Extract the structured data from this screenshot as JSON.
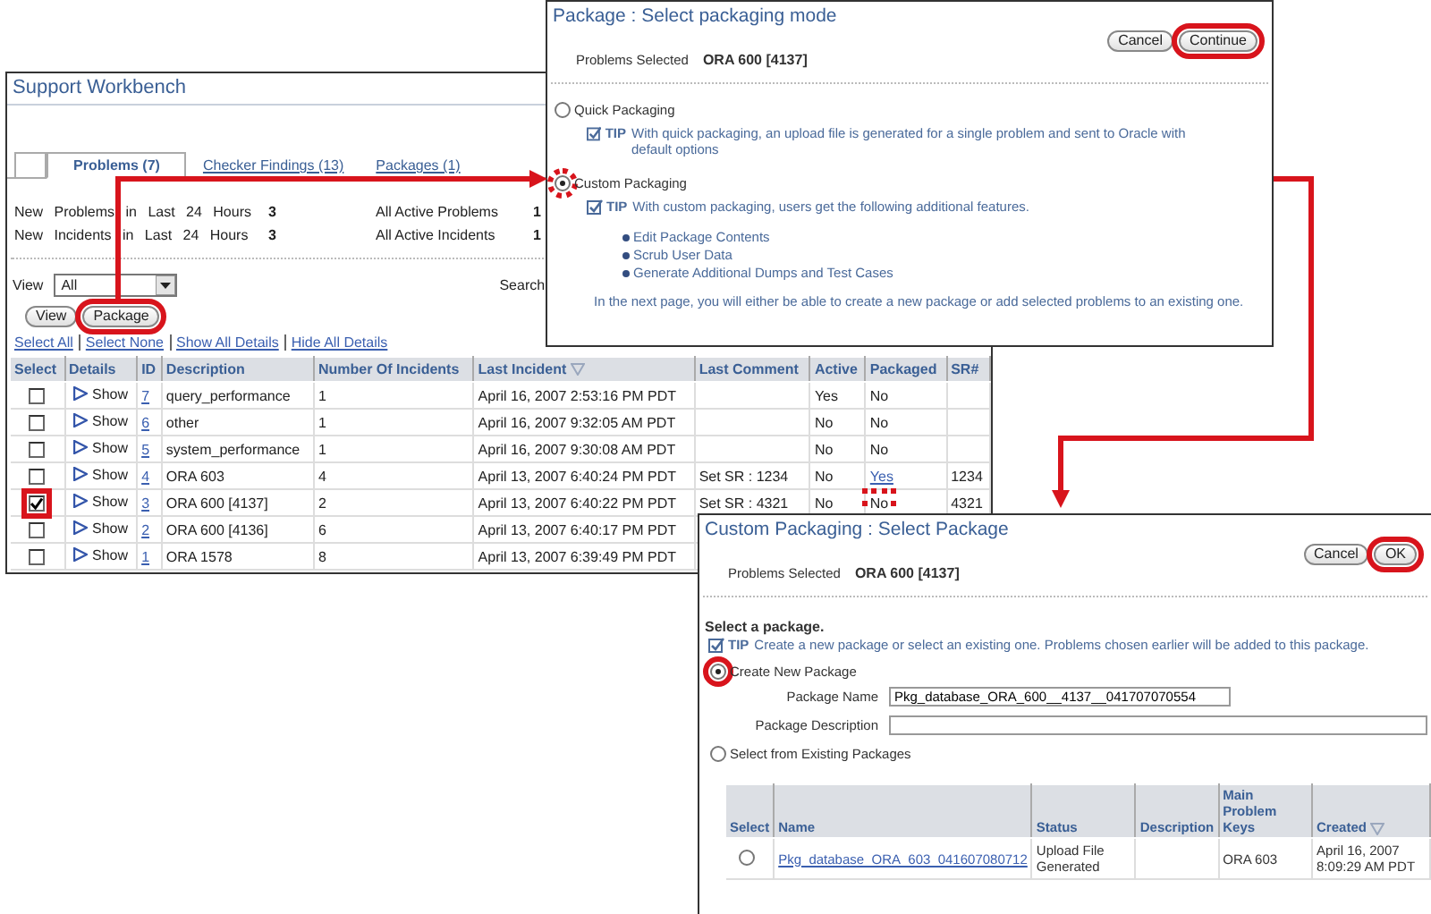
{
  "main_window": {
    "title": "Support Workbench",
    "tabs": [
      {
        "label": "Problems (7)",
        "selected": true
      },
      {
        "label": "Checker Findings (13)",
        "selected": false
      },
      {
        "label": "Packages (1)",
        "selected": false
      }
    ],
    "summary": [
      {
        "label": "New Problems in Last 24 Hours",
        "value": "3",
        "label_2": "All Active Problems",
        "value_2": "1"
      },
      {
        "label": "New Incidents in Last 24 Hours",
        "value": "3",
        "label_2": "All Active Incidents",
        "value_2": "1"
      }
    ],
    "view": {
      "label": "View",
      "value": "All"
    },
    "search_label": "Search",
    "buttons": [
      {
        "label": "View",
        "highlight": false
      },
      {
        "label": "Package",
        "highlight": true
      }
    ],
    "links": [
      "Select All",
      "Select None",
      "Show All Details",
      "Hide All Details"
    ],
    "table": {
      "columns": [
        {
          "label": "Select"
        },
        {
          "label": "Details"
        },
        {
          "label": "ID"
        },
        {
          "label": "Description"
        },
        {
          "label": "Number Of Incidents"
        },
        {
          "label": "Last Incident",
          "sorted": true
        },
        {
          "label": "Last Comment"
        },
        {
          "label": "Active"
        },
        {
          "label": "Packaged"
        },
        {
          "label": "SR#"
        }
      ],
      "rows": [
        {
          "checked": false,
          "details": "Show",
          "id": "7",
          "description": "query_performance",
          "incidents": "1",
          "last_incident": "April 16, 2007 2:53:16 PM PDT",
          "active": "Yes",
          "packaged": "No"
        },
        {
          "checked": false,
          "details": "Show",
          "id": "6",
          "description": "other",
          "incidents": "1",
          "last_incident": "April 16, 2007 9:32:05 AM PDT",
          "active": "No",
          "packaged": "No"
        },
        {
          "checked": false,
          "details": "Show",
          "id": "5",
          "description": "system_performance",
          "incidents": "1",
          "last_incident": "April 16, 2007 9:30:08 AM PDT",
          "active": "No",
          "packaged": "No"
        },
        {
          "checked": false,
          "details": "Show",
          "id": "4",
          "description": "ORA 603",
          "incidents": "4",
          "last_incident": "April 13, 2007 6:40:24 PM PDT",
          "last_comment": "Set SR : 1234",
          "active": "No",
          "packaged": "Yes",
          "packaged_link": true,
          "sr": "1234"
        },
        {
          "checked": true,
          "checkbox_highlight": true,
          "details": "Show",
          "id": "3",
          "description": "ORA 600 [4137]",
          "incidents": "2",
          "last_incident": "April 13, 2007 6:40:22 PM PDT",
          "last_comment": "Set SR : 4321",
          "active": "No",
          "packaged": "No",
          "packaged_highlight": true,
          "sr": "4321"
        },
        {
          "checked": false,
          "details": "Show",
          "id": "2",
          "description": "ORA 600 [4136]",
          "incidents": "6",
          "last_incident": "April 13, 2007 6:40:17 PM PDT"
        },
        {
          "checked": false,
          "details": "Show",
          "id": "1",
          "description": "ORA 1578",
          "incidents": "8",
          "last_incident": "April 13, 2007 6:39:49 PM PDT"
        }
      ]
    }
  },
  "mode_dialog": {
    "title": "Package : Select packaging mode",
    "buttons": [
      {
        "label": "Cancel",
        "highlight": false
      },
      {
        "label": "Continue",
        "highlight": true
      }
    ],
    "problems_selected": {
      "label": "Problems Selected",
      "value": "ORA 600 [4137]"
    },
    "options": [
      {
        "label": "Quick Packaging",
        "selected": false,
        "highlight": false,
        "tip_label": "TIP",
        "tip": "With quick packaging, an upload file is generated for a single problem and sent to Oracle with default options"
      },
      {
        "label": "Custom Packaging",
        "selected": true,
        "highlight": true,
        "tip_label": "TIP",
        "tip": "With custom packaging, users get the following additional features.",
        "bullets": [
          "Edit Package Contents",
          "Scrub User Data",
          "Generate Additional Dumps and Test Cases"
        ]
      }
    ],
    "note": "In the next page, you will either be able to create a new package or add selected problems to an existing one."
  },
  "package_dialog": {
    "title": "Custom Packaging : Select Package",
    "buttons": [
      {
        "label": "Cancel",
        "highlight": false
      },
      {
        "label": "OK",
        "highlight": true
      }
    ],
    "problems_selected": {
      "label": "Problems Selected",
      "value": "ORA 600 [4137]"
    },
    "heading": "Select a package.",
    "tip_label": "TIP",
    "tip": "Create a new package or select an existing one. Problems chosen earlier will be added to this package.",
    "options": [
      {
        "label": "Create New Package",
        "selected": true,
        "highlight": true,
        "fields": [
          {
            "label": "Package Name",
            "value": "Pkg_database_ORA_600__4137__041707070554"
          },
          {
            "label": "Package Description"
          }
        ]
      },
      {
        "label": "Select from Existing Packages",
        "selected": false,
        "highlight": false
      }
    ],
    "table": {
      "columns": [
        {
          "label": "Select"
        },
        {
          "label": "Name"
        },
        {
          "label": "Status"
        },
        {
          "label": "Description"
        },
        {
          "label": "Main Problem Keys"
        },
        {
          "label": "Created",
          "sorted": true
        }
      ],
      "rows": [
        {
          "selected": false,
          "name": "Pkg_database_ORA_603_041607080712",
          "status": "Upload File Generated",
          "keys": "ORA 603",
          "created": "April 16, 2007 8:09:29 AM PDT"
        }
      ]
    }
  }
}
